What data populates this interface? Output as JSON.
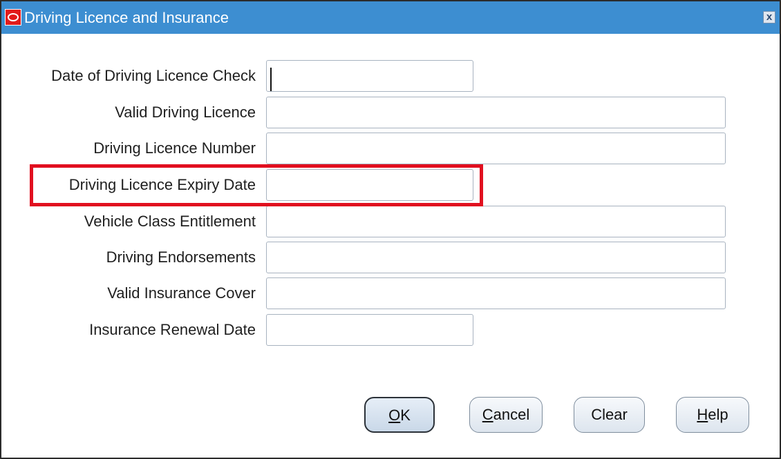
{
  "window": {
    "title": "Driving Licence and Insurance",
    "close_symbol": "x"
  },
  "fields": [
    {
      "label": "Date of Driving Licence Check",
      "value": ""
    },
    {
      "label": "Valid Driving Licence",
      "value": ""
    },
    {
      "label": "Driving Licence Number",
      "value": ""
    },
    {
      "label": "Driving Licence Expiry Date",
      "value": ""
    },
    {
      "label": "Vehicle Class Entitlement",
      "value": ""
    },
    {
      "label": "Driving Endorsements",
      "value": ""
    },
    {
      "label": "Valid Insurance Cover",
      "value": ""
    },
    {
      "label": "Insurance Renewal Date",
      "value": ""
    }
  ],
  "buttons": {
    "ok": {
      "mnemonic": "O",
      "rest": "K"
    },
    "cancel": {
      "mnemonic": "C",
      "rest": "ancel"
    },
    "clear": {
      "label": "Clear"
    },
    "help": {
      "mnemonic": "H",
      "rest": "elp"
    }
  },
  "colors": {
    "titlebar": "#3d8ed1",
    "highlight": "#e10f1f"
  },
  "icons": {
    "app": "oracle-icon",
    "close": "close-icon"
  }
}
